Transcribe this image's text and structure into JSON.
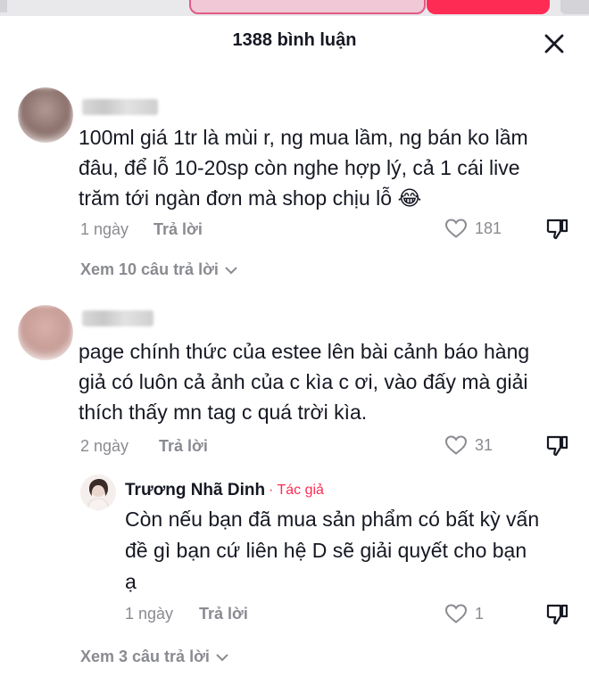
{
  "header": {
    "title": "1388 bình luận",
    "close_icon": "close-icon"
  },
  "comments": [
    {
      "text_lines": [
        "100ml giá 1tr là mùi r, ng mua lầm, ng bán ko lầm",
        "đâu, để lỗ 10-20sp còn nghe hợp lý, cả 1 cái live",
        "trăm tới ngàn đơn mà shop chịu lỗ 😂"
      ],
      "time": "1 ngày",
      "reply_label": "Trả lời",
      "likes": "181",
      "view_replies": "Xem 10 câu trả lời"
    },
    {
      "text_lines": [
        "page chính thức của estee lên bài cảnh báo hàng",
        "giả có luôn cả ảnh của c kìa c ơi, vào đấy mà giải",
        "thích thấy mn tag c quá trời kìa."
      ],
      "time": "2 ngày",
      "reply_label": "Trả lời",
      "likes": "31",
      "reply": {
        "author": "Trương Nhã Dinh",
        "badge": "· Tác giả",
        "text_lines": [
          "Còn nếu bạn đã mua sản phẩm có bất kỳ vấn",
          "đề gì bạn cứ liên hệ D sẽ giải quyết cho bạn",
          "ạ"
        ],
        "time": "1 ngày",
        "reply_label": "Trả lời",
        "likes": "1"
      },
      "view_replies": "Xem 3 câu trả lời"
    }
  ],
  "colors": {
    "accent": "#fe2c55",
    "text": "#161823",
    "meta": "#8a8b91"
  }
}
